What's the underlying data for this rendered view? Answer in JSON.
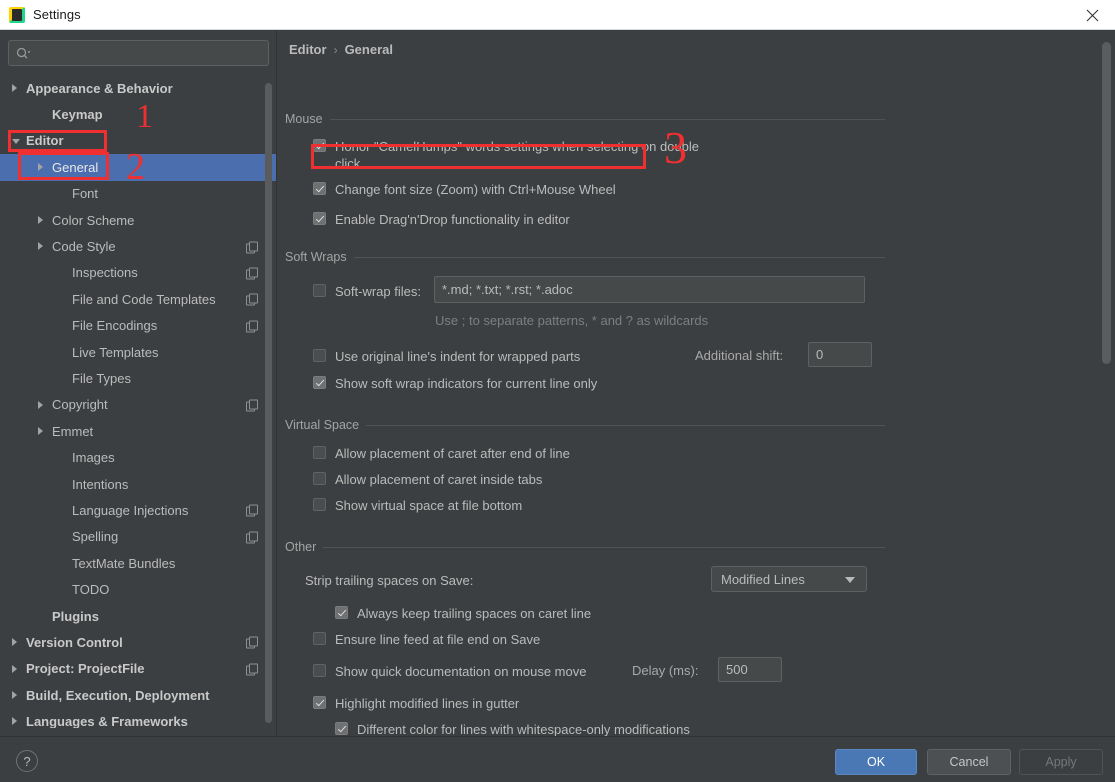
{
  "window": {
    "title": "Settings",
    "icon": "intellij-idea-icon",
    "close_label": "close-icon"
  },
  "sidebar": {
    "search": {
      "placeholder": "",
      "value": "",
      "icon": "search-icon"
    },
    "items": [
      {
        "label": "Appearance & Behavior",
        "indent": 0,
        "arrow": "right",
        "bold": true,
        "badge": false,
        "selected": false
      },
      {
        "label": "Keymap",
        "indent": 1,
        "arrow": "none",
        "bold": true,
        "badge": false,
        "selected": false
      },
      {
        "label": "Editor",
        "indent": 0,
        "arrow": "down",
        "bold": true,
        "badge": false,
        "selected": false
      },
      {
        "label": "General",
        "indent": 1,
        "arrow": "right",
        "bold": false,
        "badge": false,
        "selected": true
      },
      {
        "label": "Font",
        "indent": 2,
        "arrow": "none",
        "bold": false,
        "badge": false,
        "selected": false
      },
      {
        "label": "Color Scheme",
        "indent": 1,
        "arrow": "right",
        "bold": false,
        "badge": false,
        "selected": false
      },
      {
        "label": "Code Style",
        "indent": 1,
        "arrow": "right",
        "bold": false,
        "badge": true,
        "selected": false
      },
      {
        "label": "Inspections",
        "indent": 2,
        "arrow": "none",
        "bold": false,
        "badge": true,
        "selected": false
      },
      {
        "label": "File and Code Templates",
        "indent": 2,
        "arrow": "none",
        "bold": false,
        "badge": true,
        "selected": false
      },
      {
        "label": "File Encodings",
        "indent": 2,
        "arrow": "none",
        "bold": false,
        "badge": true,
        "selected": false
      },
      {
        "label": "Live Templates",
        "indent": 2,
        "arrow": "none",
        "bold": false,
        "badge": false,
        "selected": false
      },
      {
        "label": "File Types",
        "indent": 2,
        "arrow": "none",
        "bold": false,
        "badge": false,
        "selected": false
      },
      {
        "label": "Copyright",
        "indent": 1,
        "arrow": "right",
        "bold": false,
        "badge": true,
        "selected": false
      },
      {
        "label": "Emmet",
        "indent": 1,
        "arrow": "right",
        "bold": false,
        "badge": false,
        "selected": false
      },
      {
        "label": "Images",
        "indent": 2,
        "arrow": "none",
        "bold": false,
        "badge": false,
        "selected": false
      },
      {
        "label": "Intentions",
        "indent": 2,
        "arrow": "none",
        "bold": false,
        "badge": false,
        "selected": false
      },
      {
        "label": "Language Injections",
        "indent": 2,
        "arrow": "none",
        "bold": false,
        "badge": true,
        "selected": false
      },
      {
        "label": "Spelling",
        "indent": 2,
        "arrow": "none",
        "bold": false,
        "badge": true,
        "selected": false
      },
      {
        "label": "TextMate Bundles",
        "indent": 2,
        "arrow": "none",
        "bold": false,
        "badge": false,
        "selected": false
      },
      {
        "label": "TODO",
        "indent": 2,
        "arrow": "none",
        "bold": false,
        "badge": false,
        "selected": false
      },
      {
        "label": "Plugins",
        "indent": 1,
        "arrow": "none",
        "bold": true,
        "badge": false,
        "selected": false
      },
      {
        "label": "Version Control",
        "indent": 0,
        "arrow": "right",
        "bold": true,
        "badge": true,
        "selected": false
      },
      {
        "label": "Project: ProjectFile",
        "indent": 0,
        "arrow": "right",
        "bold": true,
        "badge": true,
        "selected": false
      },
      {
        "label": "Build, Execution, Deployment",
        "indent": 0,
        "arrow": "right",
        "bold": true,
        "badge": false,
        "selected": false
      },
      {
        "label": "Languages & Frameworks",
        "indent": 0,
        "arrow": "right",
        "bold": true,
        "badge": false,
        "selected": false
      }
    ]
  },
  "main": {
    "breadcrumb": {
      "root": "Editor",
      "separator": "›",
      "leaf": "General"
    },
    "groups": {
      "mouse": {
        "title": "Mouse",
        "options": [
          {
            "label": "Honor \"CamelHumps\" words settings when selecting on double click",
            "checked": true
          },
          {
            "label": "Change font size (Zoom) with Ctrl+Mouse Wheel",
            "checked": true
          },
          {
            "label": "Enable Drag'n'Drop functionality in editor",
            "checked": true
          }
        ]
      },
      "soft_wraps": {
        "title": "Soft Wraps",
        "softwrap_files_label": "Soft-wrap files:",
        "softwrap_files_checked": false,
        "softwrap_files_value": "*.md; *.txt; *.rst; *.adoc",
        "hint": "Use ; to separate patterns, * and ? as wildcards",
        "use_original_indent_label": "Use original line's indent for wrapped parts",
        "use_original_indent_checked": false,
        "additional_shift_label": "Additional shift:",
        "additional_shift_value": "0",
        "show_indicators_label": "Show soft wrap indicators for current line only",
        "show_indicators_checked": true
      },
      "virtual_space": {
        "title": "Virtual Space",
        "options": [
          {
            "label": "Allow placement of caret after end of line",
            "checked": false
          },
          {
            "label": "Allow placement of caret inside tabs",
            "checked": false
          },
          {
            "label": "Show virtual space at file bottom",
            "checked": false
          }
        ]
      },
      "other": {
        "title": "Other",
        "strip_label": "Strip trailing spaces on Save:",
        "strip_value": "Modified Lines",
        "always_keep_label": "Always keep trailing spaces on caret line",
        "always_keep_checked": true,
        "ensure_line_feed_label": "Ensure line feed at file end on Save",
        "ensure_line_feed_checked": false,
        "quick_doc_label": "Show quick documentation on mouse move",
        "quick_doc_checked": false,
        "delay_label": "Delay (ms):",
        "delay_value": "500",
        "highlight_label": "Highlight modified lines in gutter",
        "highlight_checked": true,
        "different_color_label": "Different color for lines with whitespace-only modifications",
        "different_color_checked": true
      }
    }
  },
  "footer": {
    "help_label": "?",
    "ok_label": "OK",
    "cancel_label": "Cancel",
    "apply_label": "Apply"
  },
  "annotations": {
    "accent_color": "#f03030",
    "marks": [
      {
        "name": "annotation-number-1",
        "text": "1"
      },
      {
        "name": "annotation-number-2",
        "text": "2"
      },
      {
        "name": "annotation-number-3",
        "text": "3"
      }
    ]
  }
}
